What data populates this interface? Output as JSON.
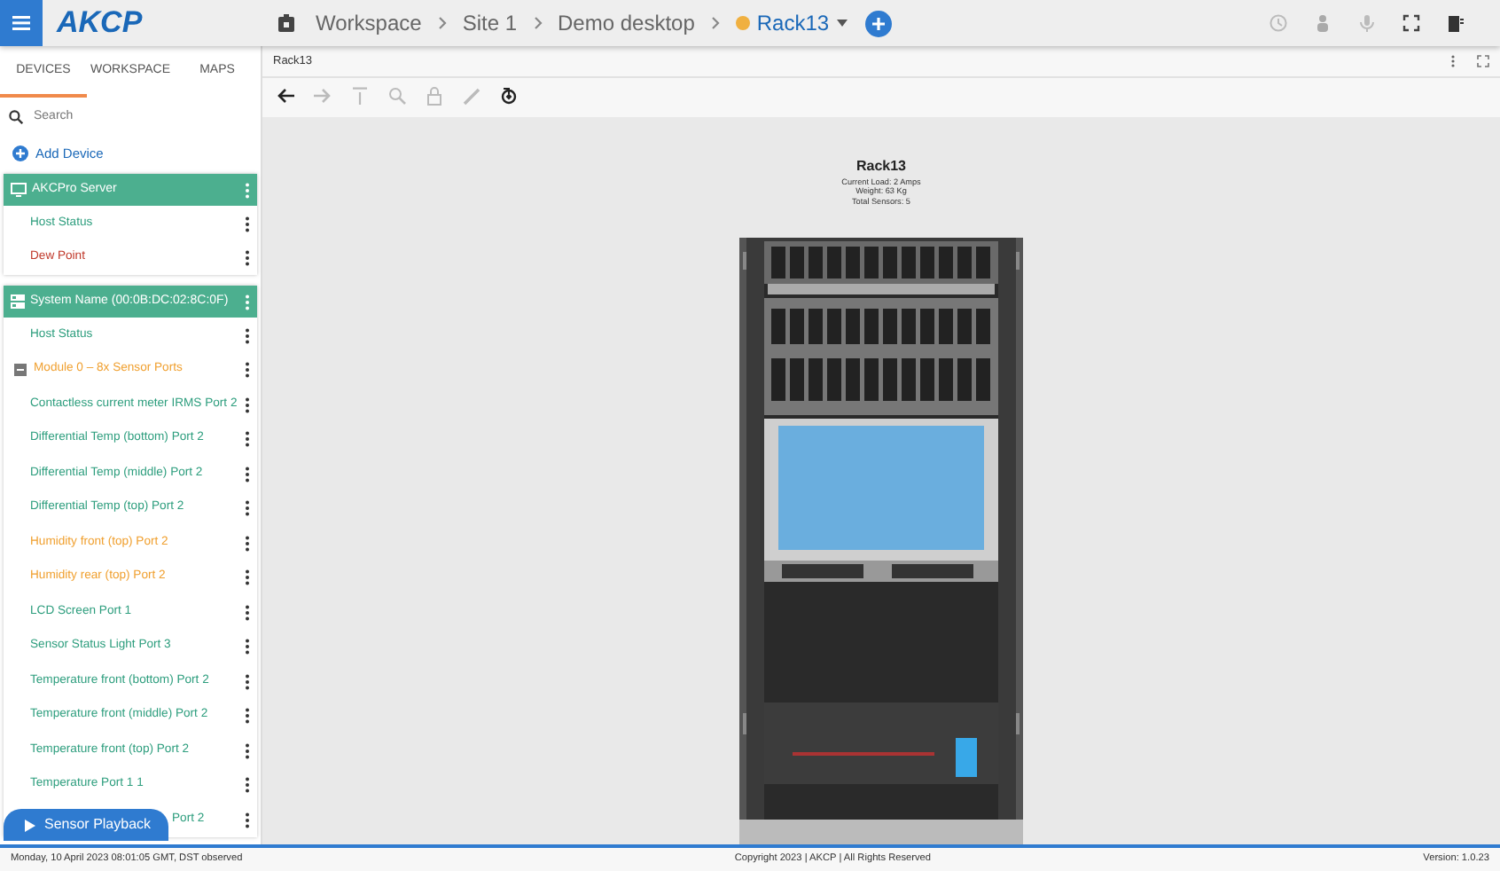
{
  "topbar": {
    "logo": "AKCP",
    "breadcrumbs": [
      {
        "label": "Workspace",
        "current": false
      },
      {
        "label": "Site 1",
        "current": false
      },
      {
        "label": "Demo desktop",
        "current": false
      },
      {
        "label": "Rack13",
        "current": true
      }
    ]
  },
  "sidebar": {
    "tabs": [
      {
        "label": "DEVICES",
        "selected": true
      },
      {
        "label": "WORKSPACE",
        "selected": false
      },
      {
        "label": "MAPS",
        "selected": false
      }
    ],
    "search": {
      "placeholder": "Search"
    },
    "add_device": "Add Device",
    "groups": [
      {
        "title": "AKCPro Server",
        "kind": "server",
        "items": [
          {
            "label": "Host Status",
            "color": "#2e9e7e"
          },
          {
            "label": "Dew Point",
            "color": "#c0392b"
          }
        ]
      },
      {
        "title": "System Name (00:0B:DC:02:8C:0F)",
        "kind": "device",
        "items": [
          {
            "label": "Host Status",
            "color": "#2e9e7e",
            "kind": "sensor"
          },
          {
            "label": "Module 0 – 8x Sensor Ports",
            "color": "#f0a030",
            "kind": "module"
          },
          {
            "label": "Contactless current meter IRMS Port 2",
            "color": "#2e9e7e",
            "kind": "sensor"
          },
          {
            "label": "Differential Temp (bottom) Port 2",
            "color": "#2e9e7e",
            "kind": "sensor"
          },
          {
            "label": "Differential Temp (middle) Port 2",
            "color": "#2e9e7e",
            "kind": "sensor"
          },
          {
            "label": "Differential Temp (top) Port 2",
            "color": "#2e9e7e",
            "kind": "sensor"
          },
          {
            "label": "Humidity front (top) Port 2",
            "color": "#f0a030",
            "kind": "sensor"
          },
          {
            "label": "Humidity rear (top) Port 2",
            "color": "#f0a030",
            "kind": "sensor"
          },
          {
            "label": "LCD Screen Port 1",
            "color": "#2e9e7e",
            "kind": "sensor"
          },
          {
            "label": "Sensor Status Light Port 3",
            "color": "#2e9e7e",
            "kind": "sensor"
          },
          {
            "label": "Temperature front (bottom) Port 2",
            "color": "#2e9e7e",
            "kind": "sensor"
          },
          {
            "label": "Temperature front (middle) Port 2",
            "color": "#2e9e7e",
            "kind": "sensor"
          },
          {
            "label": "Temperature front (top) Port 2",
            "color": "#2e9e7e",
            "kind": "sensor"
          },
          {
            "label": "Temperature Port 1 1",
            "color": "#2e9e7e",
            "kind": "sensor"
          },
          {
            "label": "Port 2",
            "color": "#2e9e7e",
            "kind": "covered"
          }
        ]
      }
    ],
    "playback_button": "Sensor Playback"
  },
  "main": {
    "tab_title": "Rack13",
    "toolbar": [
      {
        "disabled": false
      },
      {
        "disabled": true
      },
      {
        "disabled": true
      },
      {
        "disabled": true
      },
      {
        "disabled": true
      },
      {
        "disabled": true
      },
      {
        "disabled": false
      }
    ],
    "rack": {
      "title": "Rack13",
      "details": [
        "Current Load: 2 Amps",
        "Weight: 63 Kg",
        "Total Sensors: 5"
      ]
    }
  },
  "status_bar": {
    "date": "Monday, 10 April 2023 08:01:05 GMT, DST observed",
    "copyright": "Copyright 2023 | AKCP | All Rights Reserved",
    "version": "Version: 1.0.23"
  }
}
